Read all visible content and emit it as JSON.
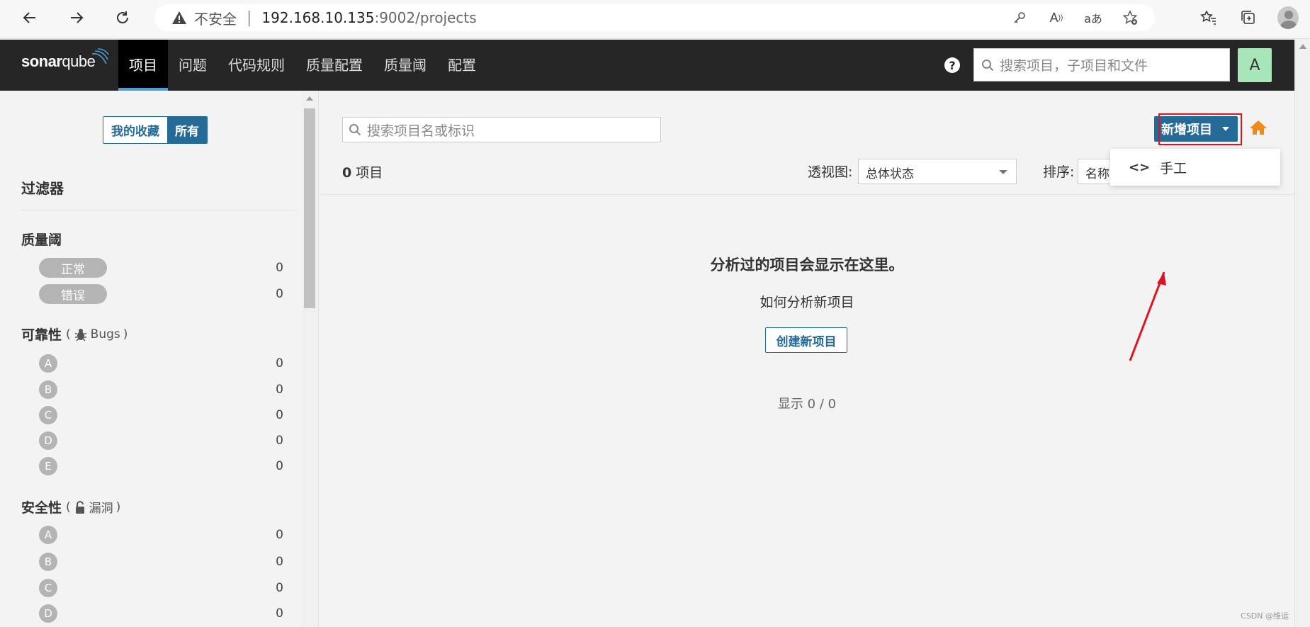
{
  "browser": {
    "security_label": "不安全",
    "url_host": "192.168.10.135",
    "url_port_path": ":9002/projects"
  },
  "nav": {
    "logo_bold": "sonar",
    "logo_light": "qube",
    "menu": [
      "项目",
      "问题",
      "代码规则",
      "质量配置",
      "质量阈",
      "配置"
    ],
    "active_index": 0,
    "help_label": "?",
    "search_placeholder": "搜索项目，子项目和文件",
    "avatar_letter": "A"
  },
  "sidebar": {
    "toggle": [
      "我的收藏",
      "所有"
    ],
    "filters_title": "过滤器",
    "quality_gate": {
      "title": "质量阈",
      "items": [
        {
          "label": "正常",
          "count": "0"
        },
        {
          "label": "错误",
          "count": "0"
        }
      ]
    },
    "reliability": {
      "title": "可靠性",
      "sub": "Bugs",
      "items": [
        {
          "grade": "A",
          "count": "0"
        },
        {
          "grade": "B",
          "count": "0"
        },
        {
          "grade": "C",
          "count": "0"
        },
        {
          "grade": "D",
          "count": "0"
        },
        {
          "grade": "E",
          "count": "0"
        }
      ]
    },
    "security": {
      "title": "安全性",
      "sub": "漏洞",
      "items": [
        {
          "grade": "A",
          "count": "0"
        },
        {
          "grade": "B",
          "count": "0"
        },
        {
          "grade": "C",
          "count": "0"
        },
        {
          "grade": "D",
          "count": "0"
        }
      ]
    }
  },
  "main": {
    "search_placeholder": "搜索项目名或标识",
    "project_count": "0",
    "project_count_label": "项目",
    "view_label": "透视图:",
    "view_value": "总体状态",
    "sort_label": "排序:",
    "sort_value": "名称",
    "new_project_label": "新增项目",
    "dropdown_item": "手工",
    "empty_title": "分析过的项目会显示在这里。",
    "empty_howto": "如何分析新项目",
    "create_button": "创建新项目",
    "showing": "显示 0 / 0"
  },
  "watermark": "CSDN @维运",
  "colors": {
    "nav_bg": "#262626",
    "primary": "#236a97",
    "avatar_bg": "#a7e6b8",
    "annotation_red": "#e0131f",
    "home_orange": "#f18a1c"
  }
}
